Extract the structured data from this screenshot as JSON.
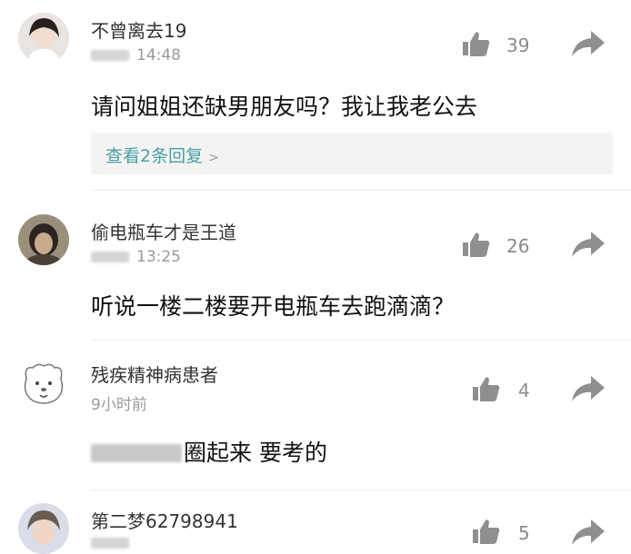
{
  "comments": [
    {
      "username": "不曾离去19",
      "time": "14:48",
      "text": "请问姐姐还缺男朋友吗？我让我老公去",
      "likes": "39",
      "reply_link": "查看2条回复"
    },
    {
      "username": "偷电瓶车才是王道",
      "time": "13:25",
      "text": "听说一楼二楼要开电瓶车去跑滴滴？",
      "likes": "26"
    },
    {
      "username": "残疾精神病患者",
      "time": "9小时前",
      "text": "圈起来 要考的",
      "likes": "4"
    },
    {
      "username": "第二梦62798941",
      "likes": "5"
    }
  ],
  "colors": {
    "reply_link": "#4a9fa2",
    "meta": "#9a9a9a",
    "icon": "#8f8f8f"
  }
}
